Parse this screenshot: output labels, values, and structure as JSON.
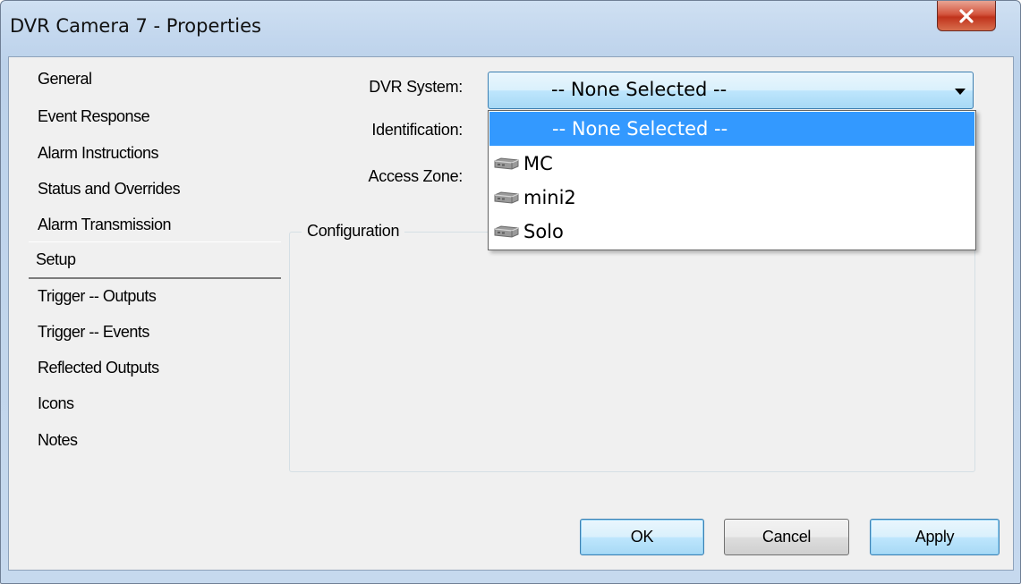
{
  "window": {
    "title": "DVR Camera 7 - Properties",
    "close_glyph": "✕"
  },
  "nav": {
    "items": [
      {
        "label": "General"
      },
      {
        "label": "Event Response"
      },
      {
        "label": "Alarm Instructions"
      },
      {
        "label": "Status and Overrides"
      },
      {
        "label": "Alarm Transmission"
      },
      {
        "label": "Setup",
        "selected": true
      },
      {
        "label": "Trigger -- Outputs"
      },
      {
        "label": "Trigger -- Events"
      },
      {
        "label": "Reflected Outputs"
      },
      {
        "label": "Icons"
      },
      {
        "label": "Notes"
      }
    ]
  },
  "form": {
    "dvr_system_label": "DVR System:",
    "identification_label": "Identification:",
    "access_zone_label": "Access Zone:",
    "dvr_system_value": "-- None Selected --",
    "dropdown_options": [
      {
        "label": "-- None Selected --",
        "icon": "",
        "selected": true
      },
      {
        "label": "MC",
        "icon": "dvr-device-icon"
      },
      {
        "label": "mini2",
        "icon": "dvr-device-icon"
      },
      {
        "label": "Solo",
        "icon": "dvr-device-icon"
      }
    ],
    "configuration_label": "Configuration"
  },
  "buttons": {
    "ok": "OK",
    "cancel": "Cancel",
    "apply": "Apply"
  },
  "colors": {
    "selection": "#3399ff",
    "close_button": "#c0331c"
  }
}
